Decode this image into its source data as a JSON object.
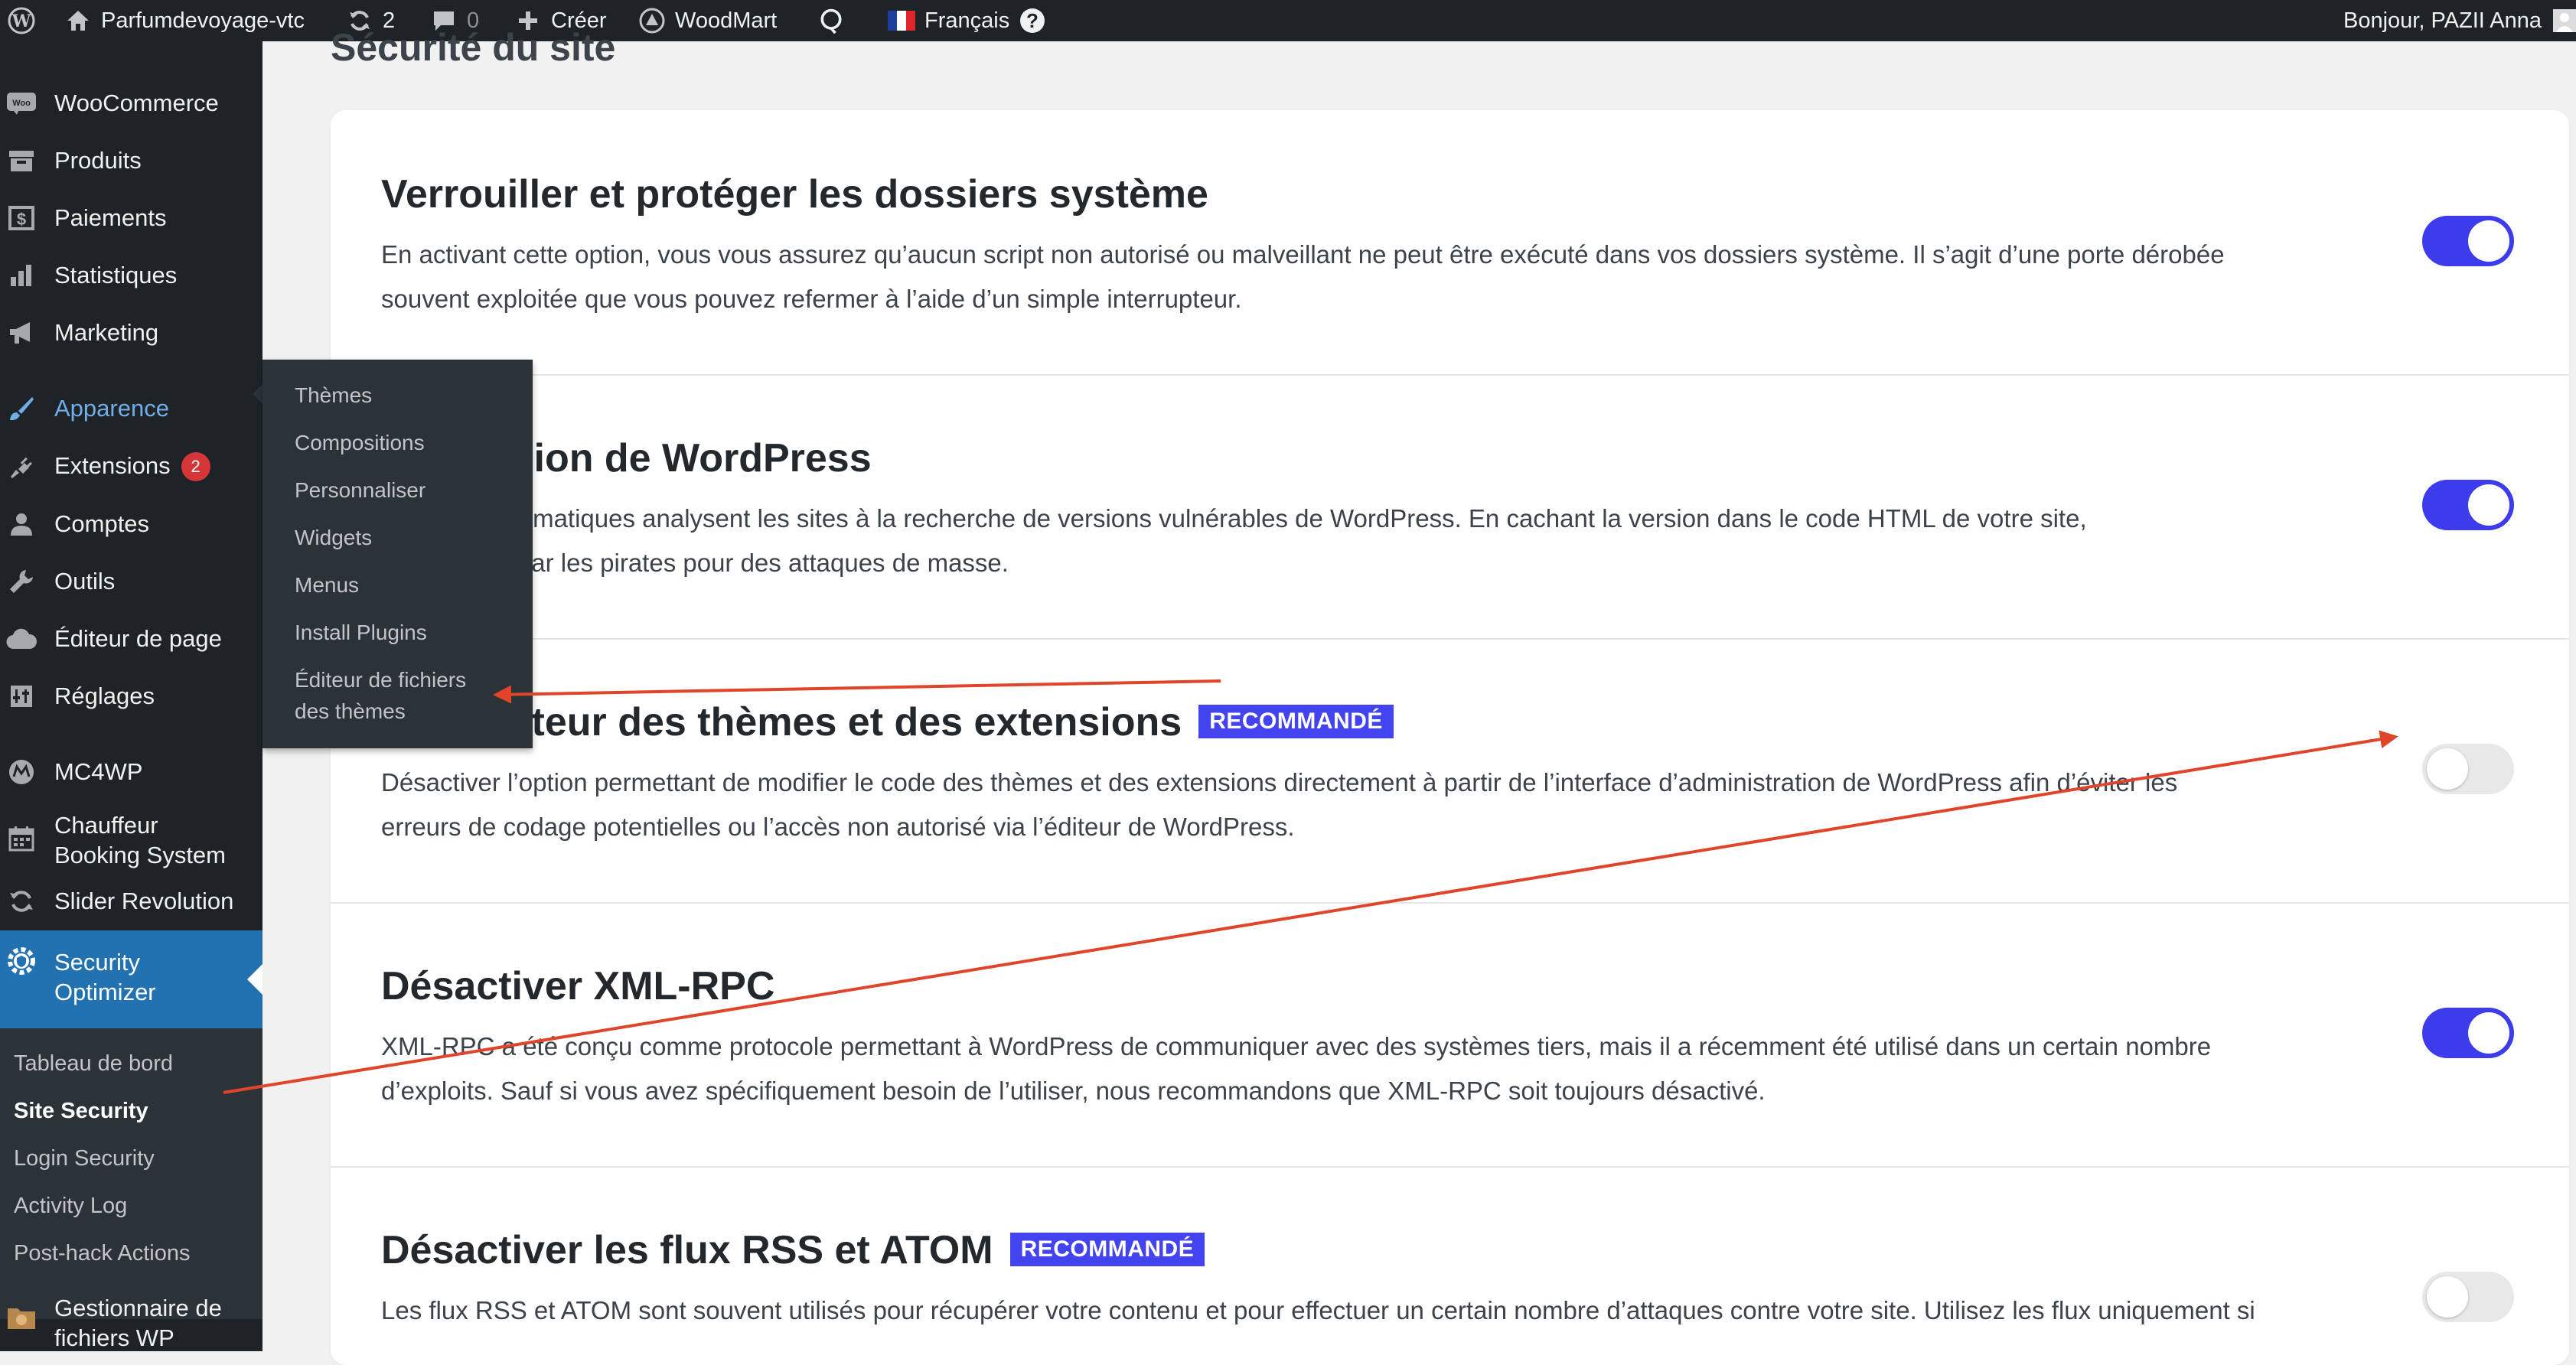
{
  "adminbar": {
    "site_name": "Parfumdevoyage-vtc",
    "updates_count": "2",
    "comments_count": "0",
    "new_label": "Créer",
    "woodmart_label": "WoodMart",
    "language_label": "Français",
    "greeting": "Bonjour, PAZII Anna"
  },
  "sidebar": {
    "items": [
      {
        "label": "WooCommerce",
        "icon": "woocommerce-icon"
      },
      {
        "label": "Produits",
        "icon": "archive-icon"
      },
      {
        "label": "Paiements",
        "icon": "dollar-icon"
      },
      {
        "label": "Statistiques",
        "icon": "bar-chart-icon"
      },
      {
        "label": "Marketing",
        "icon": "megaphone-icon"
      },
      {
        "label": "Apparence",
        "icon": "paintbrush-icon"
      },
      {
        "label": "Extensions",
        "icon": "plugin-icon",
        "badge": "2"
      },
      {
        "label": "Comptes",
        "icon": "user-icon"
      },
      {
        "label": "Outils",
        "icon": "wrench-icon"
      },
      {
        "label": "Éditeur de page",
        "icon": "cloud-icon"
      },
      {
        "label": "Réglages",
        "icon": "settings-icon"
      },
      {
        "label": "MC4WP",
        "icon": "mc4wp-icon"
      },
      {
        "label_line1": "Chauffeur",
        "label_line2": "Booking System",
        "icon": "calendar-icon"
      },
      {
        "label": "Slider Revolution",
        "icon": "refresh-icon"
      },
      {
        "label_line1": "Security",
        "label_line2": "Optimizer",
        "icon": "shield-gear-icon"
      },
      {
        "label_line1": "Gestionnaire de",
        "label_line2": "fichiers WP",
        "icon": "folder-icon"
      }
    ],
    "security_submenu": [
      "Tableau de bord",
      "Site Security",
      "Login Security",
      "Activity Log",
      "Post-hack Actions"
    ]
  },
  "flyout": {
    "items": [
      "Thèmes",
      "Compositions",
      "Personnaliser",
      "Widgets",
      "Menus",
      "Install Plugins"
    ],
    "last_line1": "Éditeur de fichiers",
    "last_line2": "des thèmes"
  },
  "page": {
    "title": "Sécurité du site",
    "recommended_label": "RECOMMANDÉ",
    "settings": [
      {
        "title": "Verrouiller et protéger les dossiers système",
        "desc_line1": "En activant cette option, vous vous assurez qu’aucun script non autorisé ou malveillant ne peut être exécuté dans vos dossiers système. Il s’agit d’une porte dérobée",
        "desc_line2": "souvent exploitée que vous pouvez refermer à l’aide d’un simple interrupteur.",
        "enabled": true
      },
      {
        "title": "r la version de WordPress",
        "desc_line1": "x pirates informatiques analysent les sites à la recherche de versions vulnérables de WordPress. En cachant la version dans le code HTML de votre site,",
        "desc_line2": "’être repéré par les pirates pour des attaques de masse.",
        "enabled": true
      },
      {
        "title": "ver l’éditeur des thèmes et des extensions",
        "recommended": true,
        "desc_line1": "Désactiver l’option permettant de modifier le code des thèmes et des extensions directement à partir de l’interface d’administration de WordPress afin d’éviter les",
        "desc_line2": "erreurs de codage potentielles ou l’accès non autorisé via l’éditeur de WordPress.",
        "enabled": false
      },
      {
        "title": "Désactiver XML-RPC",
        "desc_line1": "XML-RPC a été conçu comme protocole permettant à WordPress de communiquer avec des systèmes tiers, mais il a récemment été utilisé dans un certain nombre",
        "desc_line2": "d’exploits. Sauf si vous avez spécifiquement besoin de l’utiliser, nous recommandons que XML-RPC soit toujours désactivé.",
        "enabled": true
      },
      {
        "title": "Désactiver les flux RSS et ATOM",
        "recommended": true,
        "desc_line1": "Les flux RSS et ATOM sont souvent utilisés pour récupérer votre contenu et pour effectuer un certain nombre d’attaques contre votre site. Utilisez les flux uniquement si",
        "enabled": false
      }
    ]
  },
  "colors": {
    "admin_dark": "#1d2327",
    "submenu_bg": "#2c3338",
    "current_menu": "#2271b1",
    "toggle_on": "#3c3cec",
    "recommended_badge": "#4343f0",
    "annotation_arrow": "#e0452b"
  }
}
